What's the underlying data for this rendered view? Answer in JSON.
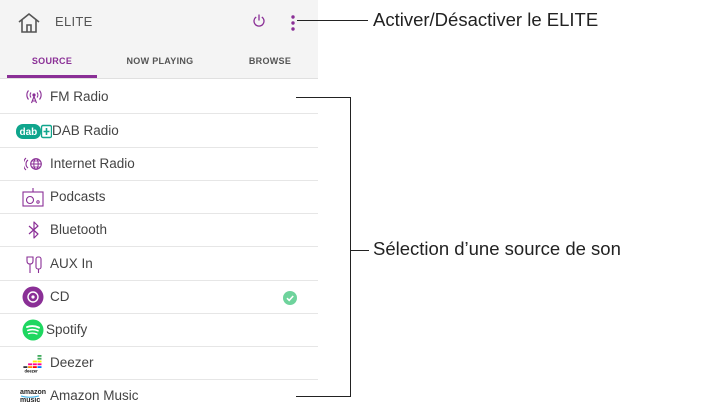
{
  "header": {
    "device_name": "ELITE"
  },
  "tabs": [
    {
      "label": "SOURCE",
      "active": true
    },
    {
      "label": "NOW PLAYING",
      "active": false
    },
    {
      "label": "BROWSE",
      "active": false
    }
  ],
  "sources": [
    {
      "label": "FM Radio",
      "icon": "fm-radio-icon"
    },
    {
      "label": "DAB Radio",
      "icon": "dab-logo-icon"
    },
    {
      "label": "Internet Radio",
      "icon": "internet-radio-icon"
    },
    {
      "label": "Podcasts",
      "icon": "podcast-icon"
    },
    {
      "label": "Bluetooth",
      "icon": "bluetooth-icon"
    },
    {
      "label": "AUX In",
      "icon": "aux-cable-icon"
    },
    {
      "label": "CD",
      "icon": "cd-icon",
      "selected": true
    },
    {
      "label": "Spotify",
      "icon": "spotify-icon"
    },
    {
      "label": "Deezer",
      "icon": "deezer-icon"
    },
    {
      "label": "Amazon Music",
      "icon": "amazon-music-icon"
    }
  ],
  "callouts": {
    "power": "Activer/Désactiver le ELITE",
    "source": "Sélection d’une source de son"
  },
  "colors": {
    "accent": "#8a2f96",
    "check": "#6ed39c",
    "spotify": "#1ed760",
    "dab": "#0fa58c"
  }
}
